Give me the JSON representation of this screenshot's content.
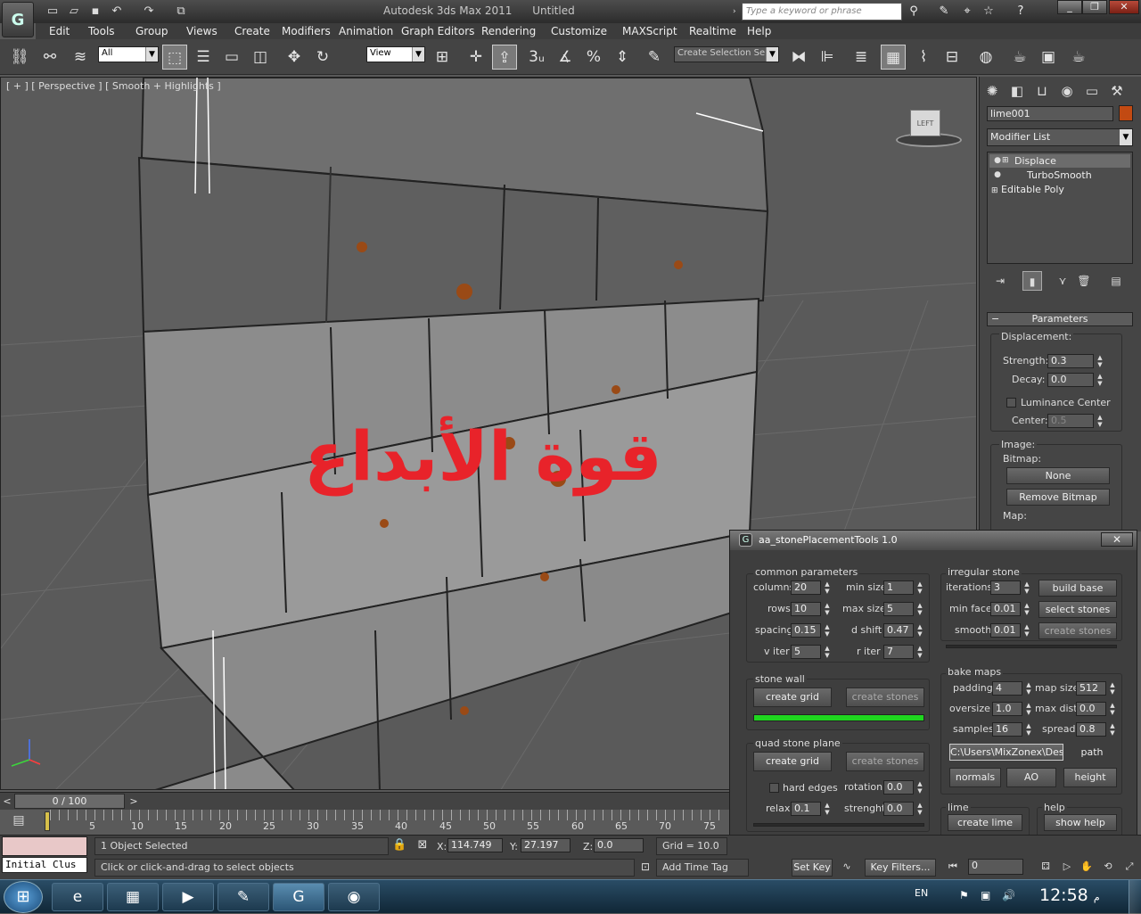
{
  "titlebar": {
    "app_title": "Autodesk 3ds Max 2011",
    "doc_title": "Untitled",
    "search_placeholder": "Type a keyword or phrase",
    "logo_icon": "3ds-max-logo-icon"
  },
  "menu": [
    "Edit",
    "Tools",
    "Group",
    "Views",
    "Create",
    "Modifiers",
    "Animation",
    "Graph Editors",
    "Rendering",
    "Customize",
    "MAXScript",
    "Realtime",
    "Help"
  ],
  "toolbar": {
    "selection_filter": "All",
    "ref_coord": "View",
    "named_selection": "Create Selection Se",
    "snap_label": "3"
  },
  "viewport": {
    "label": "[ + ] [ Perspective ] [ Smooth + Highlights ]",
    "overlay_text": "قوة الأبداع",
    "overlay_color": "#e8232a",
    "viewcube_face": "LEFT"
  },
  "command_panel": {
    "object_name": "lime001",
    "object_color": "#c24a12",
    "modifier_list": "Modifier List",
    "stack": [
      "Displace",
      "TurboSmooth",
      "Editable Poly"
    ],
    "rollout_title": "Parameters",
    "displacement_label": "Displacement:",
    "strength_label": "Strength:",
    "strength_value": "0.3",
    "decay_label": "Decay:",
    "decay_value": "0.0",
    "luminance_label": "Luminance Center",
    "center_label": "Center:",
    "center_value": "0.5",
    "image_label": "Image:",
    "bitmap_label": "Bitmap:",
    "bitmap_button": "None",
    "remove_bitmap": "Remove Bitmap",
    "map_label": "Map:"
  },
  "dialog": {
    "title": "aa_stonePlacementTools 1.0",
    "common": {
      "title": "common parameters",
      "columns_label": "columns",
      "columns": "20",
      "rows_label": "rows",
      "rows": "10",
      "spacing_label": "spacing",
      "spacing": "0.15",
      "viter_label": "v iter",
      "viter": "5",
      "minsize_label": "min size",
      "minsize": "1",
      "maxsize_label": "max size",
      "maxsize": "5",
      "dshift_label": "d shift",
      "dshift": "0.47",
      "riter_label": "r iter",
      "riter": "7"
    },
    "stone_wall": {
      "title": "stone wall",
      "create_grid": "create grid",
      "create_stones": "create stones",
      "progress": 1.0
    },
    "quad": {
      "title": "quad stone plane",
      "create_grid": "create grid",
      "create_stones": "create stones",
      "hard_edges": "hard edges",
      "rotation_label": "rotation",
      "rotation": "0.0",
      "relax_label": "relax",
      "relax": "0.1",
      "strenght_label": "strenght",
      "strenght": "0.0"
    },
    "irregular": {
      "title": "irregular stone",
      "iterations_label": "iterations",
      "iterations": "3",
      "minface_label": "min face",
      "minface": "0.01",
      "smooth_label": "smooth",
      "smooth": "0.01",
      "build_base": "build base",
      "select_stones": "select stones",
      "create_stones": "create stones"
    },
    "bake": {
      "title": "bake maps",
      "padding_label": "padding",
      "padding": "4",
      "mapsize_label": "map size",
      "mapsize": "512",
      "oversize_label": "oversize",
      "oversize": "1.0",
      "maxdist_label": "max dist",
      "maxdist": "0.0",
      "samples_label": "samples",
      "samples": "16",
      "spread_label": "spread",
      "spread": "0.8",
      "path_value": "C:\\Users\\MixZonex\\Desk",
      "path_button": "path",
      "normals": "normals",
      "ao": "AO",
      "height": "height"
    },
    "lime": {
      "title": "lime",
      "button": "create lime"
    },
    "help": {
      "title": "help",
      "button": "show help"
    }
  },
  "timeline": {
    "frame_label": "0 / 100",
    "ticks": [
      "5",
      "10",
      "15",
      "20",
      "25",
      "30",
      "35",
      "40",
      "45",
      "50",
      "55",
      "60",
      "65",
      "70",
      "75"
    ]
  },
  "status": {
    "selected": "1 Object Selected",
    "prompt": "Click or click-and-drag to select objects",
    "x_label": "X:",
    "x": "114.749",
    "y_label": "Y:",
    "y": "27.197",
    "z_label": "Z:",
    "z": "0.0",
    "grid": "Grid = 10.0",
    "add_time_tag": "Add Time Tag",
    "set_key": "Set Key",
    "key_filters": "Key Filters...",
    "frame": "0",
    "listener": "Initial Clus"
  },
  "taskbar": {
    "lang": "EN",
    "time": "12:58",
    "ampm": "م"
  }
}
